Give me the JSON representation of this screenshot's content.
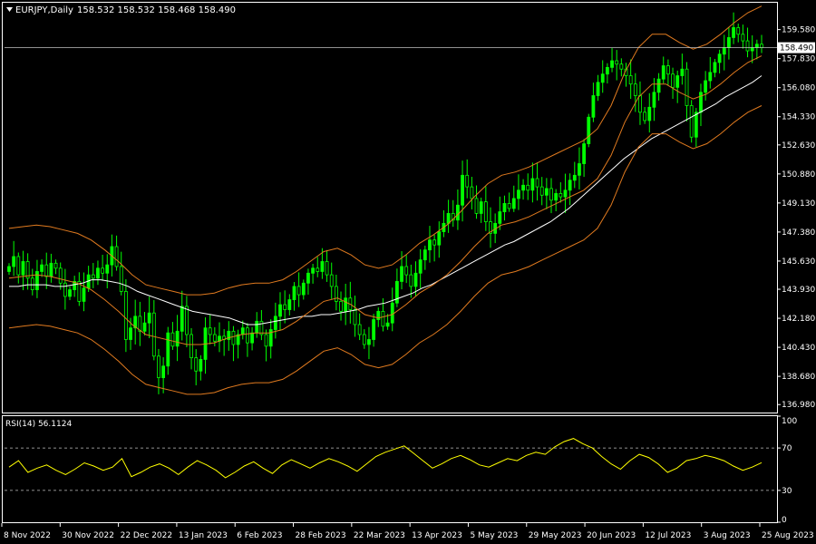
{
  "window": {
    "symbol_header": "EURJPY,Daily",
    "ohlc_header": "158.532 158.532 158.468 158.490"
  },
  "colors": {
    "background": "#000000",
    "frame": "#FFFFFF",
    "candle": "#00FF00",
    "ma_slow": "#FFFFFF",
    "bands": "#E07A1F",
    "rsi": "#FFFF00",
    "price_line": "#C0C0C0"
  },
  "chart_data": [
    {
      "type": "line",
      "name": "EURJPY price",
      "legend": "",
      "current_price": 158.49,
      "y_ticks": [
        "159.580",
        "157.830",
        "156.080",
        "154.330",
        "152.630",
        "150.880",
        "149.130",
        "147.380",
        "145.630",
        "143.930",
        "142.180",
        "140.430",
        "138.680",
        "136.980"
      ],
      "ylim": [
        136.5,
        161.2
      ],
      "x_tick_labels": [
        "8 Nov 2022",
        "30 Nov 2022",
        "22 Dec 2022",
        "13 Jan 2023",
        "6 Feb 2023",
        "28 Feb 2023",
        "22 Mar 2023",
        "13 Apr 2023",
        "5 May 2023",
        "29 May 2023",
        "20 Jun 2023",
        "12 Jul 2023",
        "3 Aug 2023",
        "25 Aug 2023"
      ],
      "close": [
        145.3,
        145.9,
        144.8,
        145.6,
        144.6,
        143.9,
        145.0,
        145.4,
        144.7,
        145.5,
        145.2,
        144.3,
        143.5,
        143.9,
        144.4,
        143.2,
        144.0,
        144.8,
        144.6,
        145.2,
        144.9,
        145.4,
        146.5,
        145.3,
        143.8,
        140.9,
        141.6,
        142.3,
        141.4,
        141.9,
        142.5,
        139.9,
        138.6,
        139.3,
        141.3,
        140.5,
        141.4,
        142.9,
        141.2,
        139.8,
        139.0,
        139.7,
        141.6,
        141.2,
        140.8,
        141.1,
        140.9,
        141.4,
        140.6,
        141.2,
        141.6,
        140.7,
        141.3,
        142.0,
        141.2,
        140.5,
        141.5,
        142.3,
        143.0,
        142.7,
        143.3,
        144.1,
        143.6,
        144.3,
        144.9,
        145.2,
        145.0,
        145.6,
        144.8,
        144.1,
        143.2,
        142.6,
        143.4,
        142.7,
        141.8,
        141.2,
        140.6,
        140.9,
        142.1,
        142.6,
        141.7,
        141.9,
        143.1,
        144.4,
        145.3,
        144.8,
        144.1,
        144.9,
        145.7,
        146.3,
        146.9,
        146.6,
        147.4,
        147.9,
        148.5,
        148.1,
        149.0,
        150.8,
        150.1,
        149.4,
        148.5,
        149.2,
        148.0,
        147.3,
        147.9,
        148.6,
        149.1,
        148.8,
        149.4,
        149.9,
        150.2,
        149.9,
        150.6,
        150.1,
        149.6,
        150.0,
        149.3,
        149.7,
        149.5,
        149.9,
        150.5,
        150.8,
        151.5,
        152.7,
        154.3,
        155.6,
        156.4,
        156.9,
        157.3,
        157.7,
        157.5,
        157.2,
        156.8,
        156.3,
        155.6,
        154.6,
        154.1,
        154.9,
        155.8,
        156.6,
        157.4,
        156.9,
        156.1,
        156.8,
        157.2,
        155.0,
        153.1,
        154.6,
        155.8,
        156.5,
        157.0,
        157.6,
        158.1,
        158.5,
        159.1,
        159.7,
        159.3,
        158.9,
        158.3,
        158.5,
        158.7,
        158.49
      ],
      "ma_slow": [
        144.1,
        144.1,
        144.2,
        144.2,
        144.2,
        144.1,
        144.1,
        144.2,
        144.3,
        144.5,
        144.5,
        144.4,
        144.3,
        144.1,
        143.8,
        143.6,
        143.4,
        143.2,
        143.0,
        142.8,
        142.6,
        142.5,
        142.4,
        142.3,
        142.2,
        142.0,
        141.8,
        141.8,
        141.9,
        142.0,
        142.1,
        142.2,
        142.3,
        142.3,
        142.4,
        142.4,
        142.5,
        142.6,
        142.7,
        142.9,
        143.0,
        143.1,
        143.3,
        143.5,
        143.7,
        144.0,
        144.2,
        144.5,
        144.8,
        145.1,
        145.4,
        145.7,
        146.0,
        146.3,
        146.6,
        146.8,
        147.1,
        147.4,
        147.7,
        148.0,
        148.4,
        148.8,
        149.3,
        149.8,
        150.3,
        150.8,
        151.3,
        151.8,
        152.2,
        152.6,
        153.0,
        153.3,
        153.6,
        153.9,
        154.2,
        154.5,
        154.8,
        155.1,
        155.5,
        155.8,
        156.1,
        156.4,
        156.8
      ],
      "ma_mid": [
        144.6,
        144.7,
        144.8,
        144.7,
        144.5,
        144.3,
        143.9,
        143.3,
        142.6,
        141.8,
        141.2,
        141.0,
        140.8,
        140.6,
        140.6,
        140.7,
        141.0,
        141.2,
        141.3,
        141.3,
        141.5,
        142.0,
        142.6,
        143.2,
        143.4,
        143.0,
        142.4,
        142.2,
        142.4,
        143.0,
        143.7,
        144.2,
        144.8,
        145.6,
        146.5,
        147.3,
        147.8,
        148.0,
        148.3,
        148.7,
        149.1,
        149.5,
        149.9,
        150.6,
        152.0,
        154.0,
        155.5,
        156.3,
        156.3,
        155.8,
        155.4,
        155.7,
        156.3,
        157.0,
        157.6,
        158.0
      ]
    },
    {
      "type": "line",
      "name": "RSI(14)",
      "legend": "RSI(14) 56.1124",
      "y_ticks": [
        "100",
        "70",
        "30",
        "0"
      ],
      "levels": [
        70,
        30
      ],
      "ylim": [
        0,
        100
      ],
      "values": [
        52,
        58,
        47,
        51,
        54,
        49,
        45,
        50,
        56,
        53,
        49,
        52,
        60,
        43,
        47,
        52,
        55,
        51,
        45,
        52,
        58,
        54,
        49,
        42,
        47,
        53,
        57,
        51,
        46,
        54,
        59,
        55,
        51,
        56,
        60,
        57,
        53,
        48,
        55,
        62,
        66,
        69,
        72,
        65,
        58,
        51,
        55,
        60,
        63,
        59,
        54,
        52,
        56,
        60,
        58,
        63,
        66,
        64,
        71,
        76,
        79,
        74,
        70,
        62,
        55,
        50,
        58,
        64,
        61,
        55,
        47,
        51,
        58,
        60,
        63,
        61,
        58,
        53,
        49,
        52,
        56.1124
      ]
    }
  ]
}
